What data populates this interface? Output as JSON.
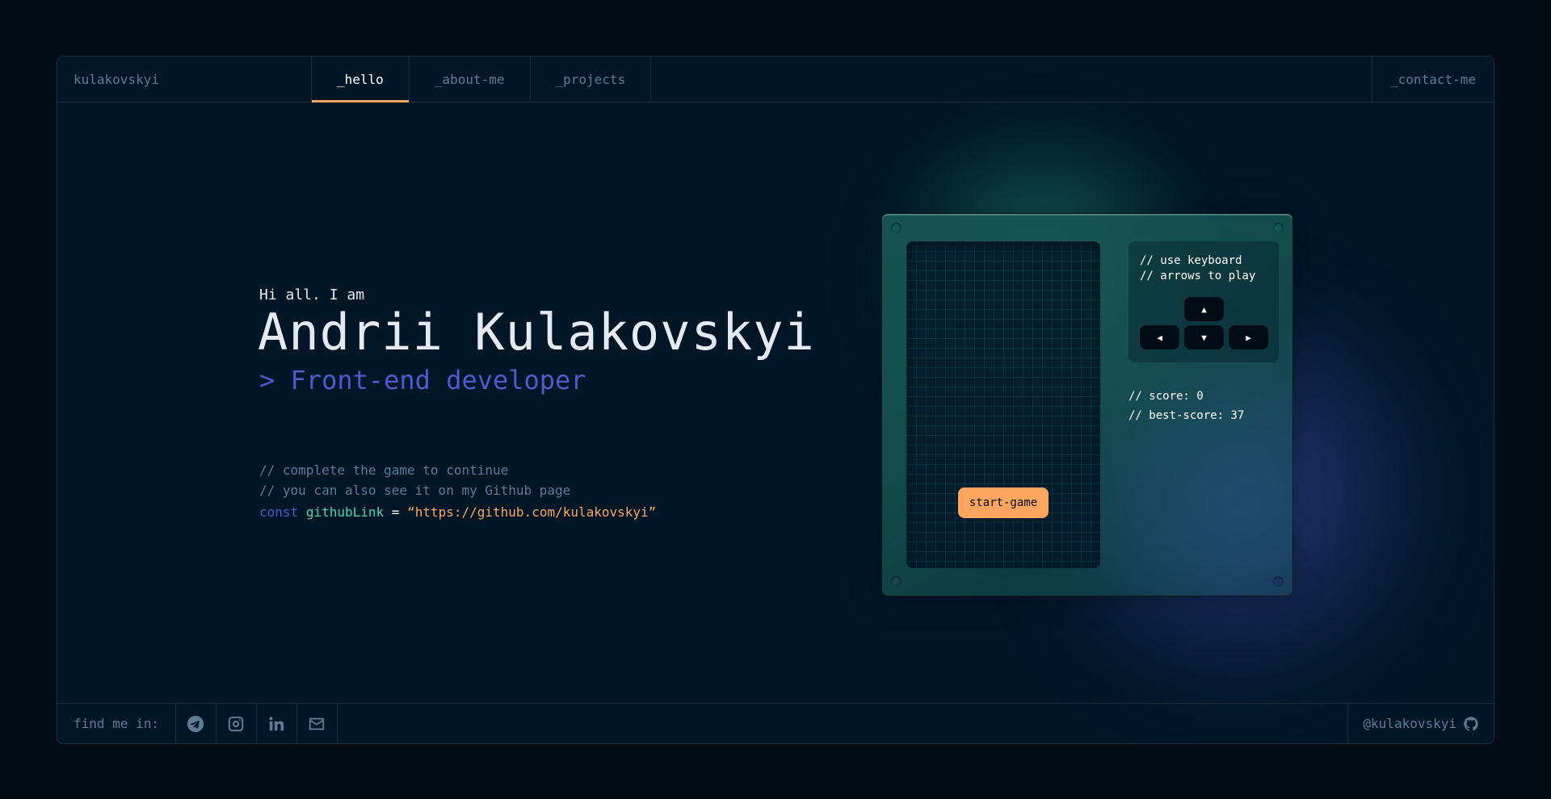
{
  "header": {
    "brand": "kulakovskyi",
    "tabs": [
      {
        "label": "_hello",
        "active": true
      },
      {
        "label": "_about-me",
        "active": false
      },
      {
        "label": "_projects",
        "active": false
      }
    ],
    "contact": "_contact-me"
  },
  "hero": {
    "greeting": "Hi all. I am",
    "name": "Andrii Kulakovskyi",
    "role": "> Front-end developer",
    "comment1": "// complete the game to continue",
    "comment2": "// you can also see it on my Github page",
    "code": {
      "keyword": "const",
      "variable": "githubLink",
      "operator": "=",
      "value": "“https://github.com/kulakovskyi”"
    }
  },
  "game": {
    "instructions_line1": "// use keyboard",
    "instructions_line2": "// arrows to play",
    "start_button": "start-game",
    "score": "// score: 0",
    "best_score": "// best-score: 37",
    "keys": {
      "up": "▲",
      "left": "◀",
      "down": "▼",
      "right": "▶"
    }
  },
  "footer": {
    "find_me": "find me in:",
    "socials": [
      "telegram-icon",
      "instagram-icon",
      "linkedin-icon",
      "mail-icon"
    ],
    "handle": "@kulakovskyi"
  },
  "colors": {
    "background": "#010c15",
    "panel": "#011627",
    "accent_orange": "#fea55f",
    "accent_green": "#43d9ad",
    "accent_indigo": "#4d5bce",
    "muted": "#607b96"
  }
}
